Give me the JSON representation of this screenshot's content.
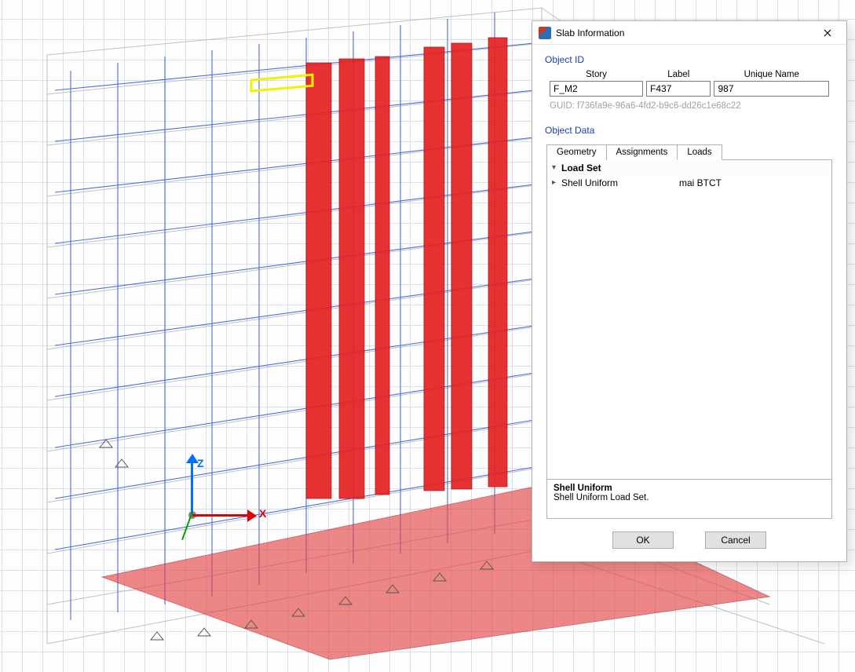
{
  "dialog": {
    "title": "Slab Information",
    "object_id": {
      "label": "Object ID",
      "headers": {
        "story": "Story",
        "label": "Label",
        "unique": "Unique Name"
      },
      "values": {
        "story": "F_M2",
        "label": "F437",
        "unique": "987"
      },
      "guid_label": "GUID:",
      "guid": "f736fa9e-96a6-4fd2-b9c6-dd26c1e68c22"
    },
    "object_data": {
      "label": "Object Data",
      "tabs": {
        "geometry": "Geometry",
        "assignments": "Assignments",
        "loads": "Loads"
      },
      "active_tab": "loads",
      "loads": {
        "group_name": "Load Set",
        "rows": [
          {
            "name": "Shell Uniform",
            "value": "mai BTCT"
          }
        ]
      },
      "description": {
        "title": "Shell Uniform",
        "text": "Shell Uniform Load Set."
      }
    },
    "buttons": {
      "ok": "OK",
      "cancel": "Cancel"
    }
  },
  "axes": {
    "x": "X",
    "z": "Z"
  }
}
